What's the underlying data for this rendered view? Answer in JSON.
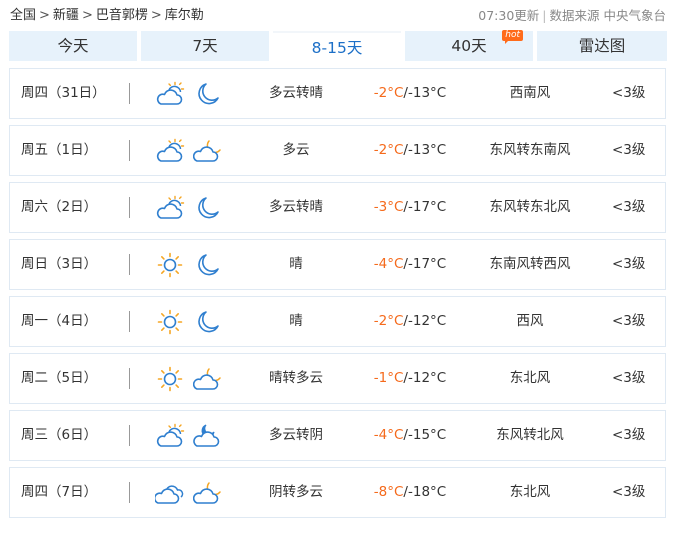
{
  "breadcrumb": {
    "items": [
      "全国",
      "新疆",
      "巴音郭楞",
      "库尔勒"
    ],
    "separator": ">"
  },
  "update_info": {
    "time": "07:30更新",
    "divider": "|",
    "source": "数据来源 中央气象台"
  },
  "tabs": [
    {
      "label": "今天",
      "active": false
    },
    {
      "label": "7天",
      "active": false
    },
    {
      "label": "8-15天",
      "active": true
    },
    {
      "label": "40天",
      "active": false,
      "badge": "hot"
    },
    {
      "label": "雷达图",
      "active": false
    }
  ],
  "forecast": [
    {
      "date": "周四（31日）",
      "day_icon": "partly-cloudy-day-icon",
      "night_icon": "moon-icon",
      "desc": "多云转晴",
      "high": "-2°C",
      "sep": "/",
      "low": "-13°C",
      "wind": "西南风",
      "level": "<3级"
    },
    {
      "date": "周五（1日）",
      "day_icon": "partly-cloudy-day-icon",
      "night_icon": "cloudy-night-icon",
      "desc": "多云",
      "high": "-2°C",
      "sep": "/",
      "low": "-13°C",
      "wind": "东风转东南风",
      "level": "<3级"
    },
    {
      "date": "周六（2日）",
      "day_icon": "partly-cloudy-day-icon",
      "night_icon": "moon-icon",
      "desc": "多云转晴",
      "high": "-3°C",
      "sep": "/",
      "low": "-17°C",
      "wind": "东风转东北风",
      "level": "<3级"
    },
    {
      "date": "周日（3日）",
      "day_icon": "sun-icon",
      "night_icon": "moon-icon",
      "desc": "晴",
      "high": "-4°C",
      "sep": "/",
      "low": "-17°C",
      "wind": "东南风转西风",
      "level": "<3级"
    },
    {
      "date": "周一（4日）",
      "day_icon": "sun-icon",
      "night_icon": "moon-icon",
      "desc": "晴",
      "high": "-2°C",
      "sep": "/",
      "low": "-12°C",
      "wind": "西风",
      "level": "<3级"
    },
    {
      "date": "周二（5日）",
      "day_icon": "sun-icon",
      "night_icon": "cloudy-night-icon",
      "desc": "晴转多云",
      "high": "-1°C",
      "sep": "/",
      "low": "-12°C",
      "wind": "东北风",
      "level": "<3级"
    },
    {
      "date": "周三（6日）",
      "day_icon": "partly-cloudy-day-icon",
      "night_icon": "overcast-night-icon",
      "desc": "多云转阴",
      "high": "-4°C",
      "sep": "/",
      "low": "-15°C",
      "wind": "东风转北风",
      "level": "<3级"
    },
    {
      "date": "周四（7日）",
      "day_icon": "overcast-icon",
      "night_icon": "cloudy-night-icon",
      "desc": "阴转多云",
      "high": "-8°C",
      "sep": "/",
      "low": "-18°C",
      "wind": "东北风",
      "level": "<3级"
    }
  ],
  "colors": {
    "accent": "#1c6fc7",
    "tab_bg": "#e7f2fb",
    "high_temp": "#f56a1c",
    "icon_stroke": "#2f7fcf",
    "sun": "#f5a623"
  }
}
